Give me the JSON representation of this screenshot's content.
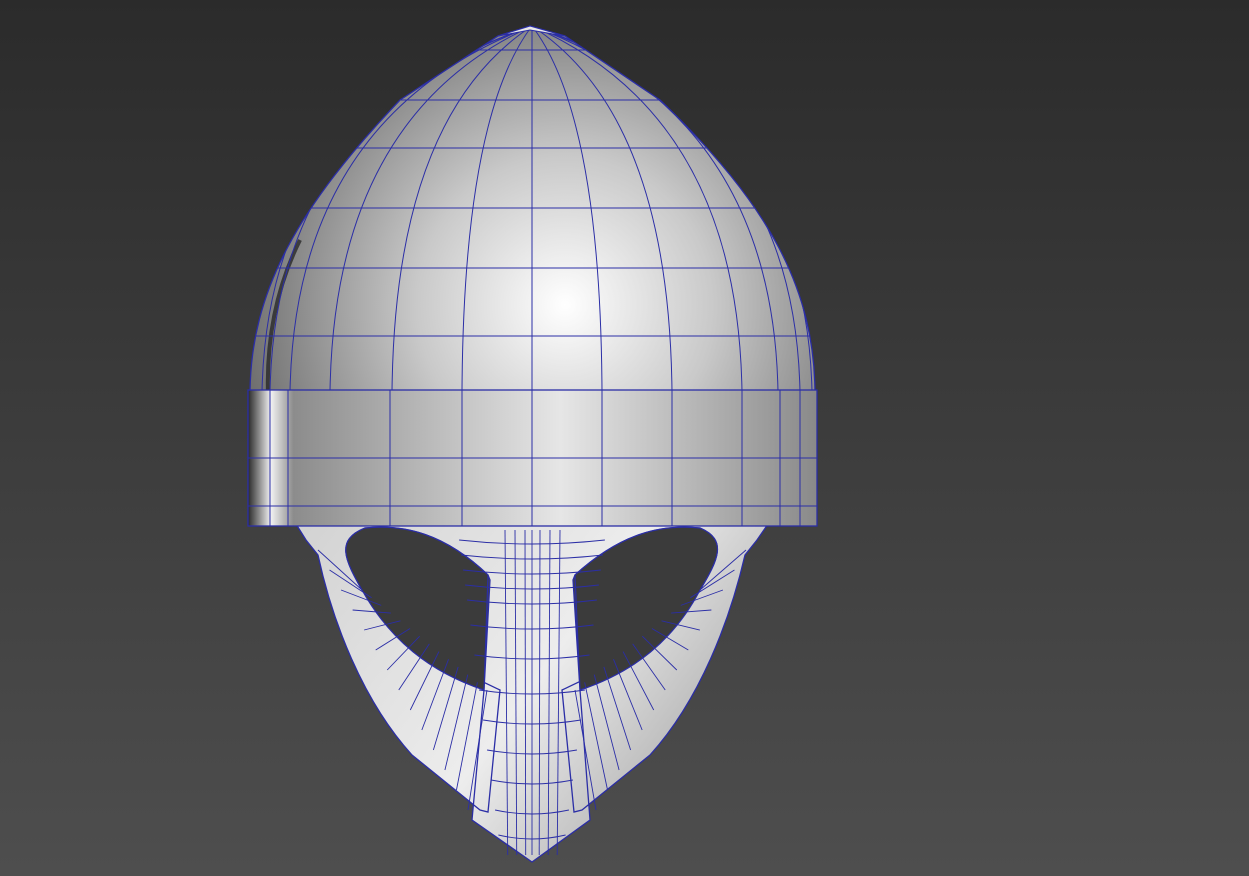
{
  "viewport": {
    "background_top": "#2b2b2b",
    "background_bottom": "#4e4e4e"
  },
  "model": {
    "object": "helmet",
    "display_mode": "shaded-with-wireframe",
    "surface_highlight": "#ffffff",
    "surface_mid": "#c9c9c9",
    "surface_shadow": "#6c6c6c",
    "wire_color": "#2b2ea6"
  }
}
